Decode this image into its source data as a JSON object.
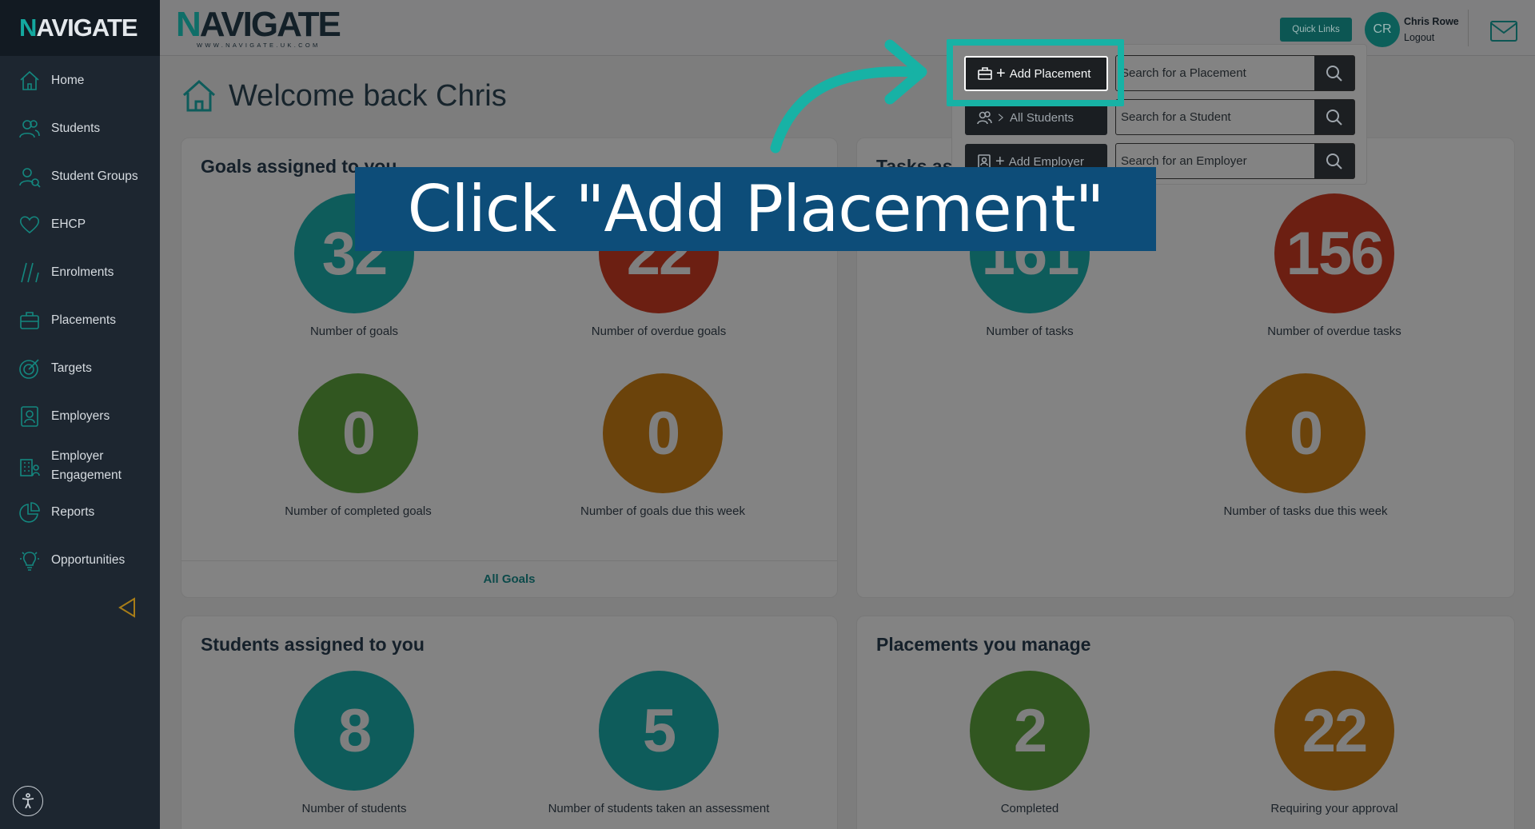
{
  "sidebar": {
    "logo_first": "N",
    "logo_rest": "AVIGATE",
    "items": [
      {
        "label": "Home",
        "icon": "home-icon"
      },
      {
        "label": "Students",
        "icon": "students-icon"
      },
      {
        "label": "Student Groups",
        "icon": "student-groups-icon"
      },
      {
        "label": "EHCP",
        "icon": "heart-icon"
      },
      {
        "label": "Enrolments",
        "icon": "enrolments-icon"
      },
      {
        "label": "Placements",
        "icon": "briefcase-icon"
      },
      {
        "label": "Targets",
        "icon": "target-icon"
      },
      {
        "label": "Employers",
        "icon": "employer-icon"
      },
      {
        "label": "Employer Engagement",
        "icon": "building-icon"
      },
      {
        "label": "Reports",
        "icon": "pie-chart-icon"
      },
      {
        "label": "Opportunities",
        "icon": "lightbulb-icon"
      }
    ]
  },
  "header": {
    "logo_first": "N",
    "logo_rest": "AVIGATE",
    "logo_url": "WWW.NAVIGATE.UK.COM",
    "quick_links": "Quick Links",
    "avatar_initials": "CR",
    "user_name": "Chris Rowe",
    "logout": "Logout"
  },
  "welcome": "Welcome back Chris",
  "goals_card": {
    "title": "Goals assigned to you",
    "stats": [
      {
        "value": "32",
        "label": "Number of goals"
      },
      {
        "value": "22",
        "label": "Number of overdue goals"
      },
      {
        "value": "0",
        "label": "Number of completed goals"
      },
      {
        "value": "0",
        "label": "Number of goals due this week"
      }
    ],
    "footer": "All Goals"
  },
  "tasks_card": {
    "title": "Tasks assigned to you",
    "stats": [
      {
        "value": "161",
        "label": "Number of tasks"
      },
      {
        "value": "156",
        "label": "Number of overdue tasks"
      },
      {
        "value": "0",
        "label": "Number of tasks due this week"
      }
    ]
  },
  "students_card": {
    "title": "Students assigned to you",
    "stats": [
      {
        "value": "8",
        "label": "Number of students"
      },
      {
        "value": "5",
        "label": "Number of students taken an assessment"
      }
    ]
  },
  "placements_card": {
    "title": "Placements you manage",
    "stats": [
      {
        "value": "2",
        "label": "Completed"
      },
      {
        "value": "22",
        "label": "Requiring your approval"
      }
    ]
  },
  "quick_actions": {
    "add_placement": "Add Placement",
    "all_students": "All Students",
    "add_employer": "Add Employer",
    "search_placement_placeholder": "Search for a Placement",
    "search_student_placeholder": "Search for a Student",
    "search_employer_placeholder": "Search for an Employer"
  },
  "banner": "Click \"Add Placement\"",
  "colors": {
    "accent_teal": "#17b2a5",
    "banner_blue": "#0d4d79",
    "sidebar_bg": "#1d2630"
  }
}
